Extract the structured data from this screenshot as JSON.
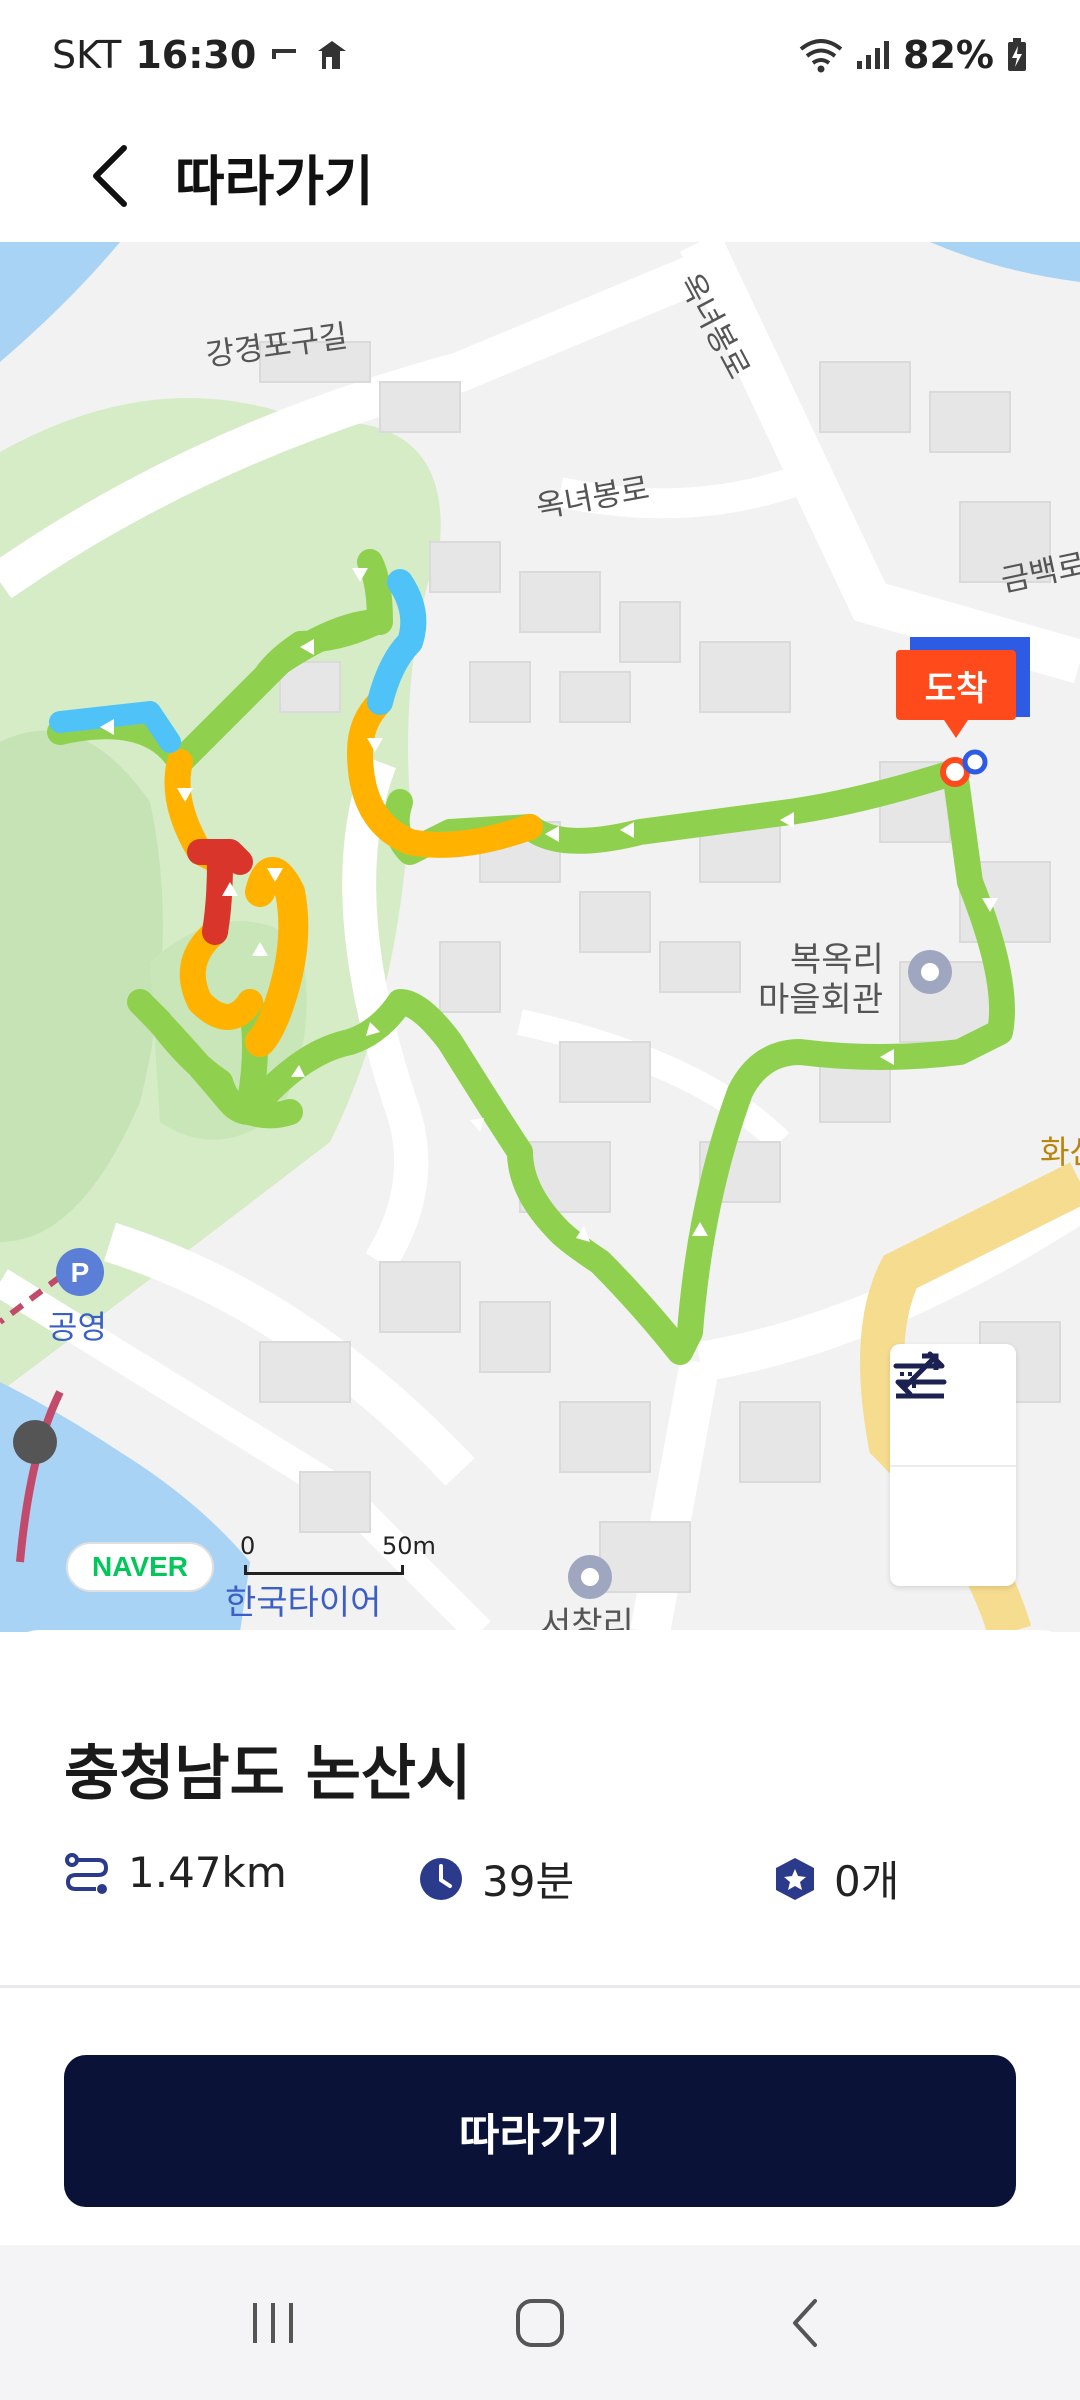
{
  "status_bar": {
    "carrier": "SKT",
    "time": "16:30",
    "battery": "82%"
  },
  "header": {
    "title": "따라가기"
  },
  "map": {
    "road_labels": [
      "강경포구길",
      "옥녀봉로",
      "옥녀봉로",
      "금백로"
    ],
    "poi_labels": [
      "복옥리",
      "마을회관",
      "공영",
      "한국타이어",
      "서창리",
      "화산"
    ],
    "arrival_label": "도착",
    "provider_logo": "NAVER",
    "scale": {
      "zero": "0",
      "distance": "50m"
    },
    "route_colors": {
      "easy": "#8fd14f",
      "moderate": "#ffb300",
      "hard": "#d9352a",
      "water": "#4fc3f7"
    },
    "controls": [
      "elevation-icon",
      "swap-icon"
    ]
  },
  "summary": {
    "region": "충청남도 논산시",
    "distance": "1.47km",
    "duration": "39분",
    "stamps": "0개",
    "icons": [
      "route-icon",
      "clock-icon",
      "stamp-icon"
    ]
  },
  "primary_action": {
    "label": "따라가기"
  },
  "nav_bar": {
    "buttons": [
      "recent-apps-icon",
      "home-icon",
      "back-icon"
    ]
  }
}
